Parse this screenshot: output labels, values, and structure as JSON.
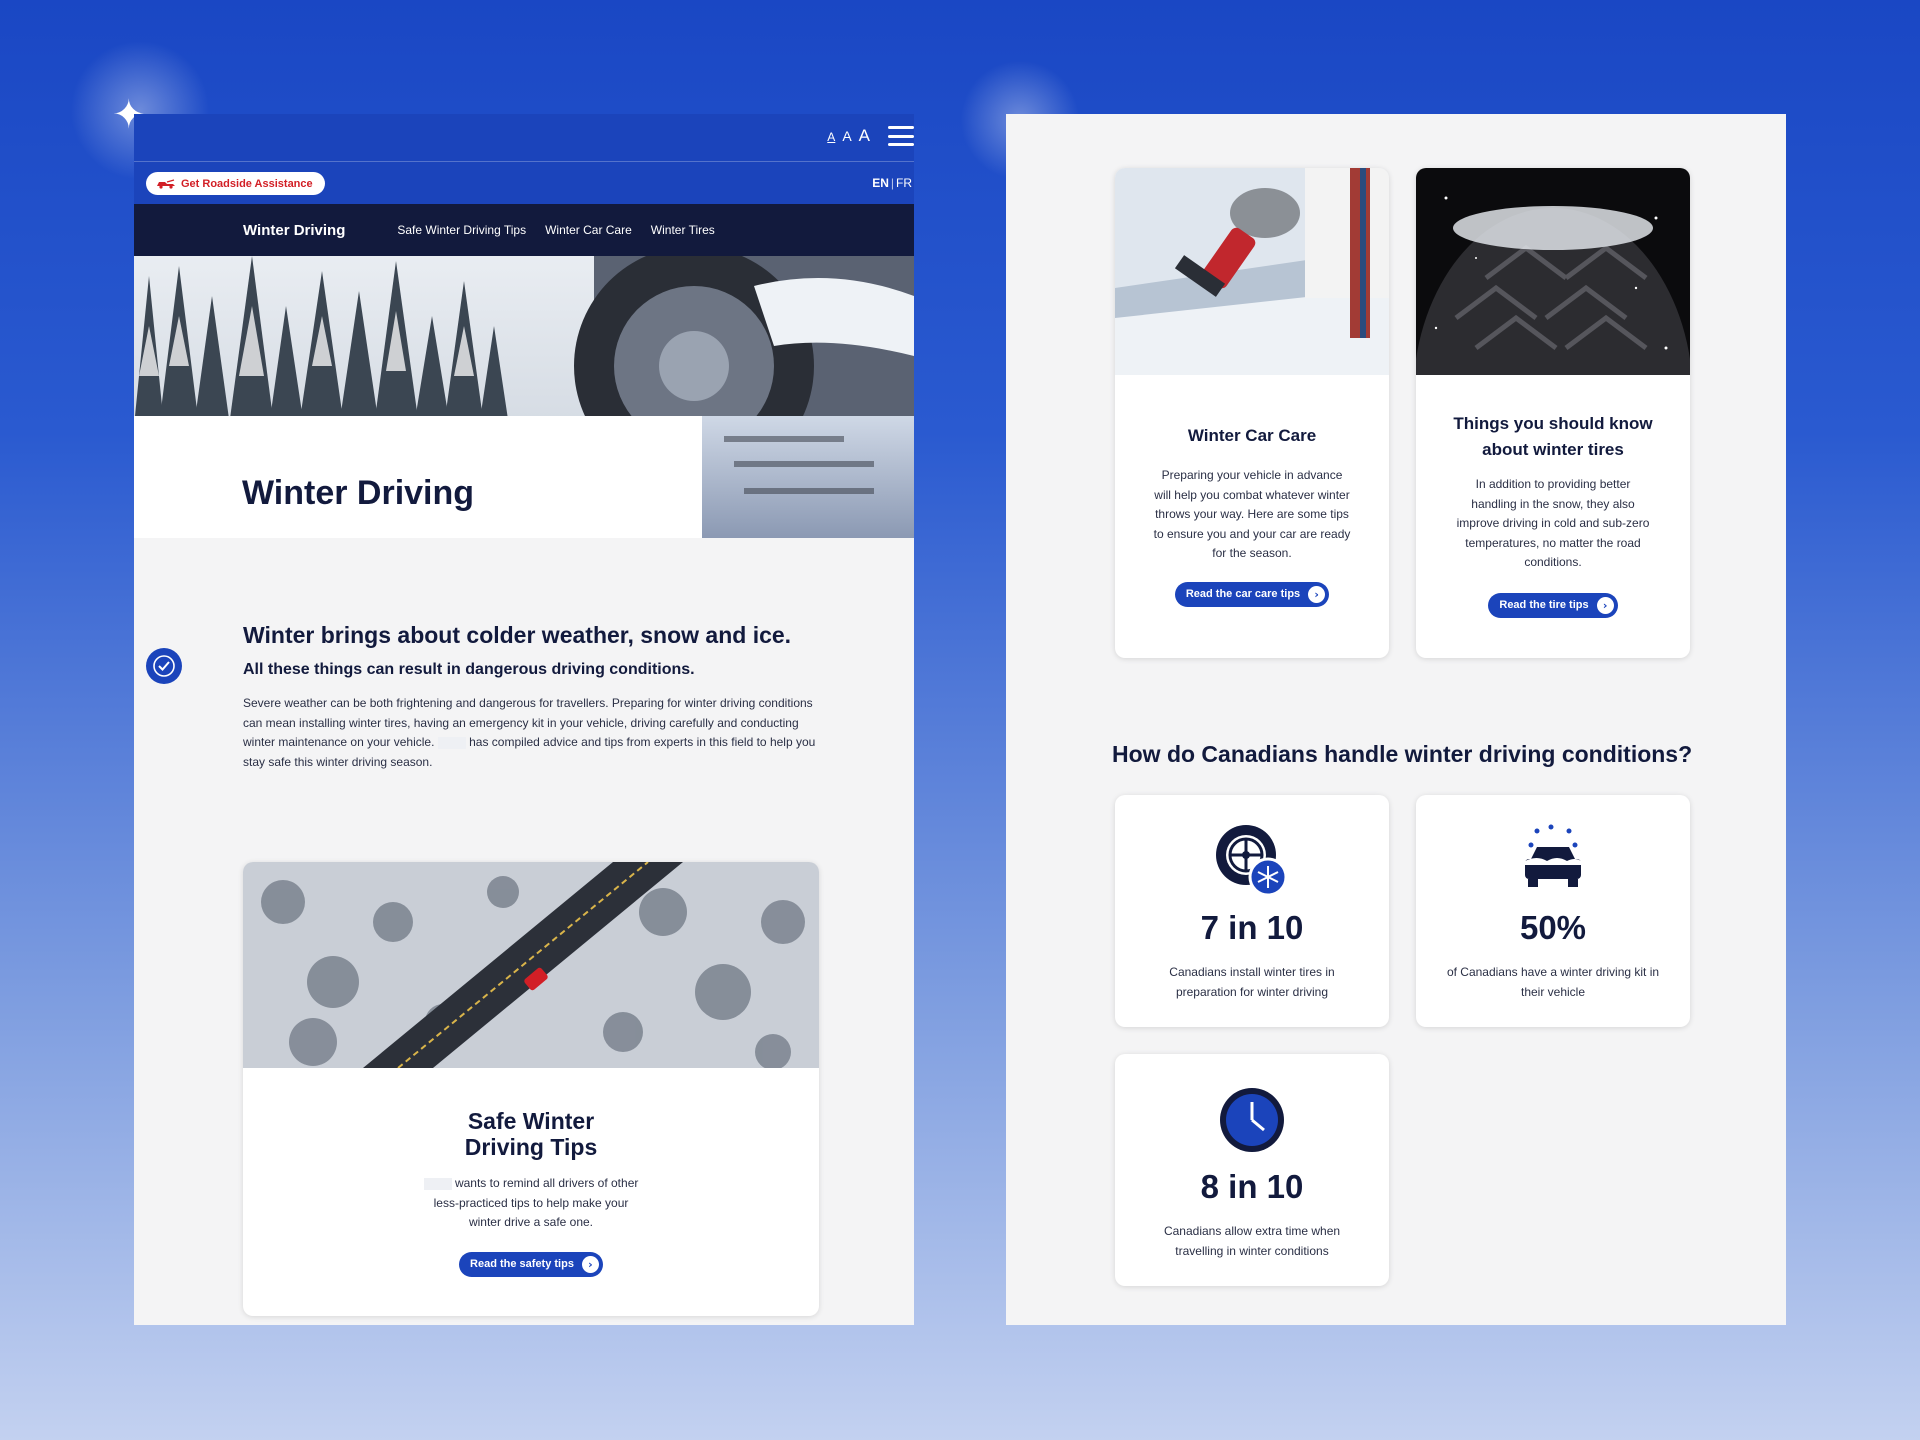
{
  "colors": {
    "brand_blue": "#1b44bb",
    "nav_dark": "#121a3d",
    "accent_red": "#d21f26",
    "panel_bg": "#f4f4f5"
  },
  "left": {
    "text_size_options": [
      "A",
      "A",
      "A"
    ],
    "menu_icon": "hamburger-menu-icon",
    "roadside_label": "Get Roadside Assistance",
    "lang_en": "EN",
    "lang_sep": "|",
    "lang_fr": "FR",
    "nav": {
      "brand": "Winter Driving",
      "links": [
        "Safe Winter Driving Tips",
        "Winter Car Care",
        "Winter Tires"
      ]
    },
    "hero_title": "Winter Driving",
    "intro": {
      "heading": "Winter brings about colder weather, snow and ice.",
      "subheading": "All these things can result in dangerous driving conditions.",
      "body_part1": "Severe weather can be both frightening and dangerous for travellers. Preparing for winter driving conditions can mean installing winter tires, having an emergency kit in your vehicle, driving carefully and conducting winter maintenance on your vehicle.",
      "body_part2": "has compiled advice and tips from experts in this field to help you stay safe this winter driving season."
    },
    "safe_card": {
      "title_line1": "Safe Winter",
      "title_line2": "Driving Tips",
      "body": "wants to remind all drivers of other less-practiced tips to help make your winter drive a safe one.",
      "button": "Read the safety tips"
    }
  },
  "right": {
    "car_care_card": {
      "title": "Winter Car Care",
      "body": "Preparing your vehicle in advance will help you combat whatever winter throws your way. Here are some tips to ensure you and your car are ready for the season.",
      "button": "Read the car care tips"
    },
    "tires_card": {
      "title": "Things you should know about winter tires",
      "body": "In addition to providing better handling in the snow, they also improve driving in cold and sub-zero temperatures, no matter the road conditions.",
      "button": "Read the tire tips"
    },
    "section_title": "How do Canadians handle winter driving conditions?",
    "stats": [
      {
        "value": "7 in 10",
        "caption": "Canadians install winter tires in preparation for winter driving",
        "icon": "tire-snowflake-icon"
      },
      {
        "value": "50%",
        "caption": "of Canadians have a winter driving kit in their vehicle",
        "icon": "snowy-car-icon"
      },
      {
        "value": "8 in 10",
        "caption": "Canadians allow extra time when travelling in winter conditions",
        "icon": "clock-icon"
      }
    ]
  }
}
